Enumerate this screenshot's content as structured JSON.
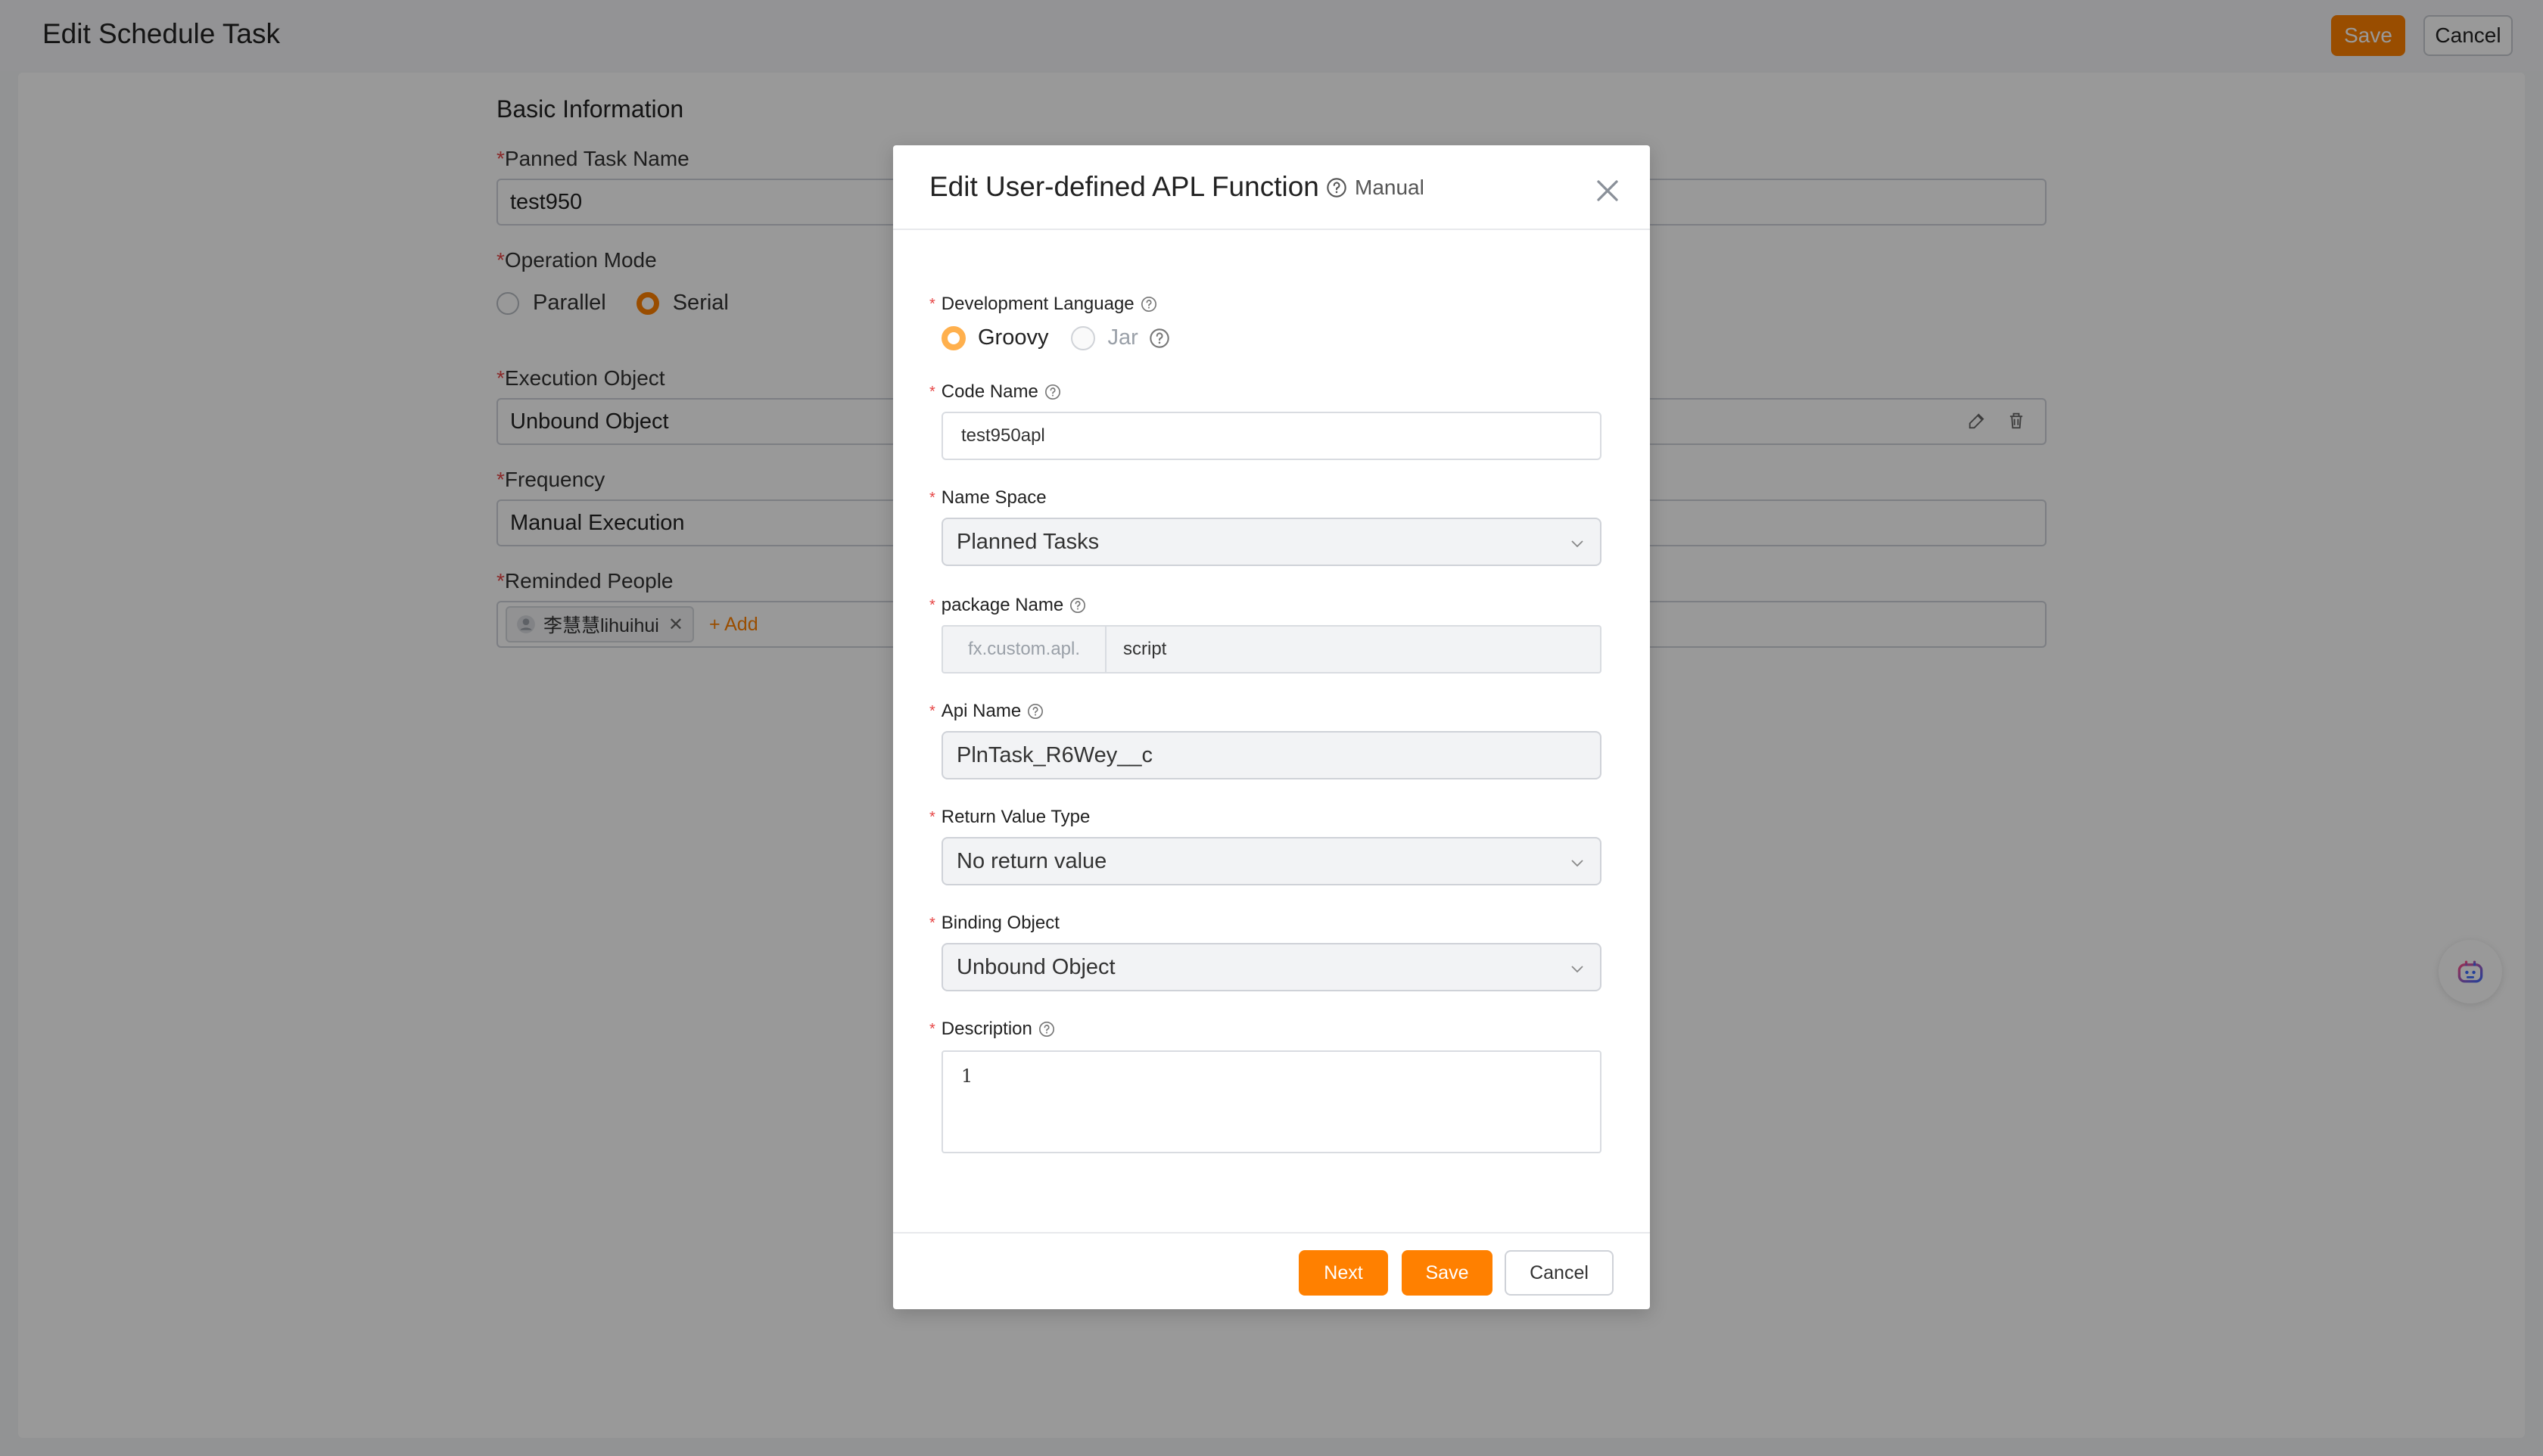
{
  "page": {
    "title": "Edit Schedule Task",
    "save_label": "Save",
    "cancel_label": "Cancel"
  },
  "form": {
    "section_title": "Basic Information",
    "task_name": {
      "label": "Panned Task Name",
      "value": "test950"
    },
    "operation_mode": {
      "label": "Operation Mode",
      "options": [
        "Parallel",
        "Serial"
      ],
      "selected": "Serial"
    },
    "execution_object": {
      "label": "Execution Object",
      "value": "Unbound Object"
    },
    "frequency": {
      "label": "Frequency",
      "value": "Manual Execution"
    },
    "reminded_people": {
      "label": "Reminded People",
      "tag": "李慧慧lihuihui",
      "add_label": "+ Add"
    }
  },
  "modal": {
    "title": "Edit User-defined APL Function",
    "manual_label": "Manual",
    "dev_language": {
      "label": "Development Language",
      "options": [
        "Groovy",
        "Jar"
      ],
      "selected": "Groovy"
    },
    "code_name": {
      "label": "Code Name",
      "value": "test950apl"
    },
    "name_space": {
      "label": "Name Space",
      "value": "Planned Tasks"
    },
    "package_name": {
      "label": "package Name",
      "prefix": "fx.custom.apl.",
      "value": "script"
    },
    "api_name": {
      "label": "Api Name",
      "value": "PlnTask_R6Wey__c"
    },
    "return_type": {
      "label": "Return Value Type",
      "value": "No return value"
    },
    "binding_object": {
      "label": "Binding Object",
      "value": "Unbound Object"
    },
    "description": {
      "label": "Description",
      "value": "1"
    },
    "next_label": "Next",
    "save_label": "Save",
    "cancel_label": "Cancel"
  },
  "colors": {
    "accent": "#ff8000",
    "required": "#e64545",
    "mask": "rgba(0,0,0,0.40)"
  }
}
